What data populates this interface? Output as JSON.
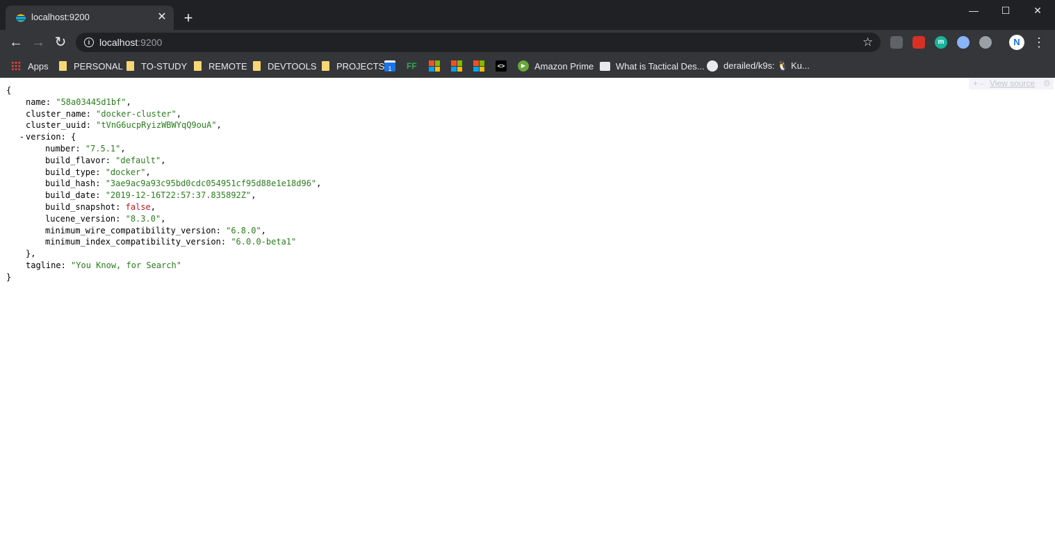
{
  "tab": {
    "title": "localhost:9200",
    "close": "✕"
  },
  "new_tab": "+",
  "window": {
    "minimize": "—",
    "maximize": "☐",
    "close": "✕"
  },
  "toolbar": {
    "url_host": "localhost",
    "url_port": ":9200",
    "back": "←",
    "forward": "→",
    "reload": "↻",
    "star": "☆",
    "menu": "⋮",
    "profile_initial": "N"
  },
  "bookmarks": [
    {
      "label": "Apps",
      "icon": "apps-grid-icon"
    },
    {
      "label": "PERSONAL",
      "icon": "folder-icon"
    },
    {
      "label": "TO-STUDY",
      "icon": "folder-icon"
    },
    {
      "label": "REMOTE",
      "icon": "folder-icon"
    },
    {
      "label": "DEVTOOLS",
      "icon": "folder-icon"
    },
    {
      "label": "PROJECTS",
      "icon": "folder-icon"
    },
    {
      "label": "",
      "icon": "calendar-icon",
      "glyph": "1"
    },
    {
      "label": "",
      "icon": "ff-icon",
      "glyph": "FF"
    },
    {
      "label": "",
      "icon": "microsoft-icon"
    },
    {
      "label": "",
      "icon": "microsoft-icon"
    },
    {
      "label": "",
      "icon": "microsoft-icon"
    },
    {
      "label": "",
      "icon": "code-icon",
      "glyph": "<>"
    },
    {
      "label": "Amazon Prime",
      "icon": "play-icon"
    },
    {
      "label": "What is Tactical Des...",
      "icon": "book-icon"
    },
    {
      "label": "derailed/k9s: 🐧 Ku...",
      "icon": "github-icon"
    }
  ],
  "json_tools": {
    "plus": "+",
    "minus": "-",
    "view_source": "View source",
    "gear": "⚙"
  },
  "json": {
    "open": "{",
    "name_key": "name",
    "name_val": "\"58a03445d1bf\"",
    "cluster_name_key": "cluster_name",
    "cluster_name_val": "\"docker-cluster\"",
    "cluster_uuid_key": "cluster_uuid",
    "cluster_uuid_val": "\"tVnG6ucpRyizWBWYqQ9ouA\"",
    "collapser": "-",
    "version_key": "version",
    "version_open": "{",
    "number_key": "number",
    "number_val": "\"7.5.1\"",
    "build_flavor_key": "build_flavor",
    "build_flavor_val": "\"default\"",
    "build_type_key": "build_type",
    "build_type_val": "\"docker\"",
    "build_hash_key": "build_hash",
    "build_hash_val": "\"3ae9ac9a93c95bd0cdc054951cf95d88e1e18d96\"",
    "build_date_key": "build_date",
    "build_date_val": "\"2019-12-16T22:57:37.835892Z\"",
    "build_snapshot_key": "build_snapshot",
    "build_snapshot_val": "false",
    "lucene_version_key": "lucene_version",
    "lucene_version_val": "\"8.3.0\"",
    "min_wire_key": "minimum_wire_compatibility_version",
    "min_wire_val": "\"6.8.0\"",
    "min_index_key": "minimum_index_compatibility_version",
    "min_index_val": "\"6.0.0-beta1\"",
    "version_close": "},",
    "tagline_key": "tagline",
    "tagline_val": "\"You Know, for Search\"",
    "close": "}"
  },
  "colors": {
    "string": "#2a7d1c",
    "boolean": "#c4141b",
    "chrome_dark": "#202124",
    "chrome_toolbar": "#35363a"
  }
}
